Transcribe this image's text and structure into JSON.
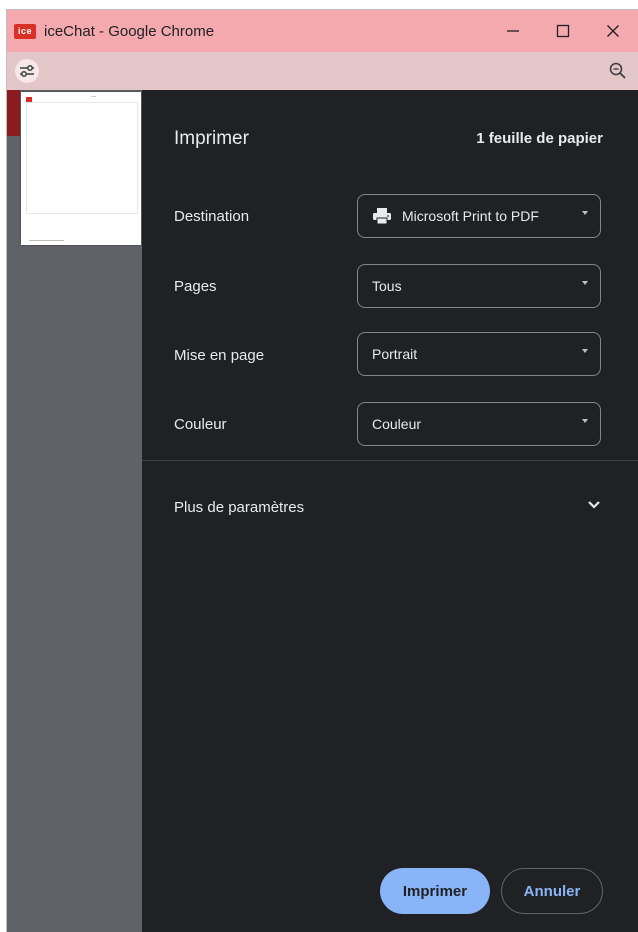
{
  "window": {
    "app_icon_text": "ice",
    "title": "iceChat - Google Chrome",
    "controls": [
      "minimize",
      "maximize",
      "close"
    ]
  },
  "toolbar": {
    "left_icon": "tune-icon",
    "right_icon": "zoom-icon"
  },
  "print_dialog": {
    "title": "Imprimer",
    "sheet_count": "1 feuille de papier",
    "rows": [
      {
        "label": "Destination",
        "value": "Microsoft Print to PDF",
        "icon": "printer-icon"
      },
      {
        "label": "Pages",
        "value": "Tous"
      },
      {
        "label": "Mise en page",
        "value": "Portrait"
      },
      {
        "label": "Couleur",
        "value": "Couleur"
      }
    ],
    "more_settings": "Plus de paramètres",
    "print_button": "Imprimer",
    "cancel_button": "Annuler"
  },
  "colors": {
    "titlebar": "#f4a9ae",
    "toolbar": "#e3c7c8",
    "panel_bg": "#202124",
    "primary_button": "#8ab4f8"
  }
}
